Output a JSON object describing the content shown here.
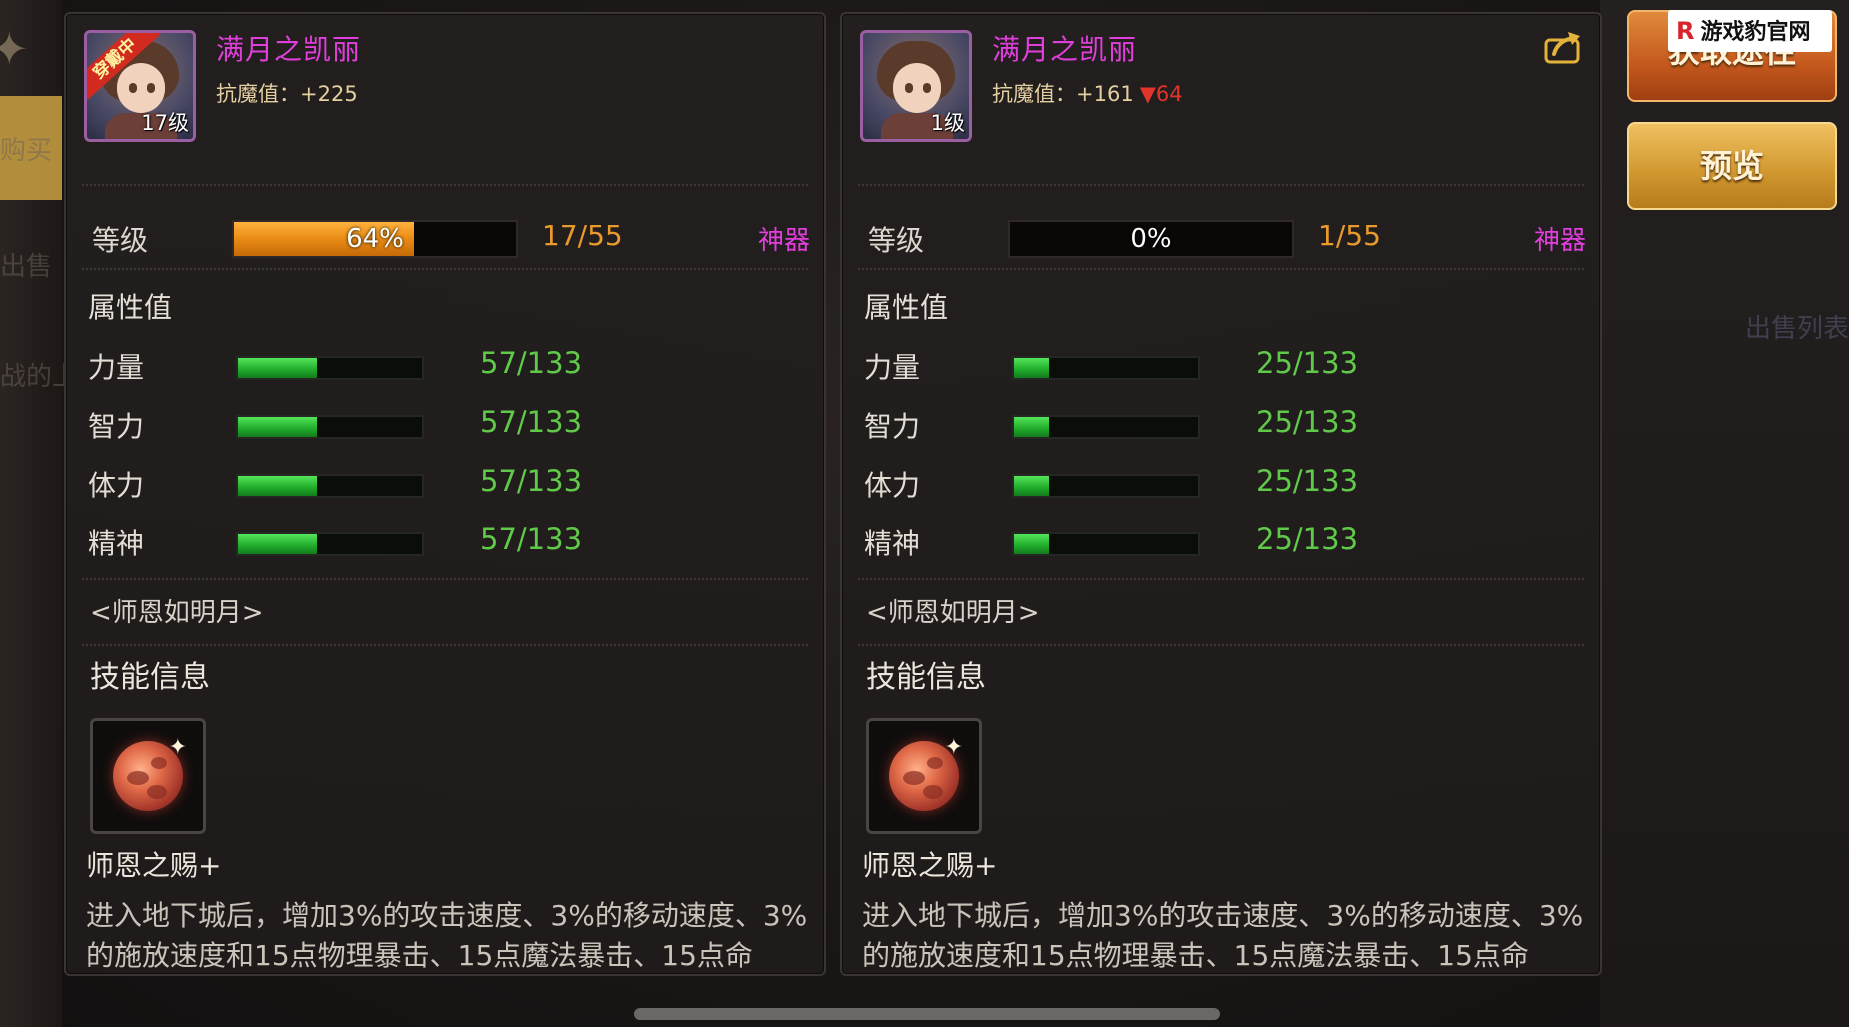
{
  "background": {
    "left_ghost_texts": [
      "购买",
      "出售",
      "战的上"
    ],
    "right_ghost_texts": [
      "出售列表"
    ]
  },
  "panels": [
    {
      "hero_name": "满月之凯丽",
      "portrait_level": "17级",
      "ribbon": "穿戴中",
      "resistance_label": "抗魔值：",
      "resistance_value": "+225",
      "resistance_down": "",
      "level_label": "等级",
      "level_percent": "64%",
      "level_progress": 0.64,
      "level_count": "17/55",
      "rarity": "神器",
      "attributes_title": "属性值",
      "stats": [
        {
          "name": "力量",
          "value": "57/133",
          "ratio": 0.4286
        },
        {
          "name": "智力",
          "value": "57/133",
          "ratio": 0.4286
        },
        {
          "name": "体力",
          "value": "57/133",
          "ratio": 0.4286
        },
        {
          "name": "精神",
          "value": "57/133",
          "ratio": 0.4286
        }
      ],
      "set_name": "<师恩如明月>",
      "skill_title": "技能信息",
      "skill_name": "师恩之赐+",
      "skill_desc": "进入地下城后，增加3%的攻击速度、3%的移动速度、3%的施放速度和15点物理暴击、15点魔法暴击、15点命"
    },
    {
      "hero_name": "满月之凯丽",
      "portrait_level": "1级",
      "ribbon": "",
      "resistance_label": "抗魔值：",
      "resistance_value": "+161",
      "resistance_down": "▼64",
      "level_label": "等级",
      "level_percent": "0%",
      "level_progress": 0,
      "level_count": "1/55",
      "rarity": "神器",
      "attributes_title": "属性值",
      "stats": [
        {
          "name": "力量",
          "value": "25/133",
          "ratio": 0.188
        },
        {
          "name": "智力",
          "value": "25/133",
          "ratio": 0.188
        },
        {
          "name": "体力",
          "value": "25/133",
          "ratio": 0.188
        },
        {
          "name": "精神",
          "value": "25/133",
          "ratio": 0.188
        }
      ],
      "set_name": "<师恩如明月>",
      "skill_title": "技能信息",
      "skill_name": "师恩之赐+",
      "skill_desc": "进入地下城后，增加3%的攻击速度、3%的移动速度、3%的施放速度和15点物理暴击、15点魔法暴击、15点命"
    }
  ],
  "buttons": {
    "obtain": "获取途径",
    "preview": "预览"
  },
  "watermark": {
    "logo": "R",
    "text": "游戏豹官网"
  },
  "icons": {
    "share": "share-arrow-icon",
    "skill": "red-moon-icon"
  },
  "colors": {
    "name": "#e03fdc",
    "rarity": "#e03fdc",
    "stat_value": "#61c94a",
    "level_count": "#e89a2c",
    "resistance_down": "#e1352b"
  }
}
